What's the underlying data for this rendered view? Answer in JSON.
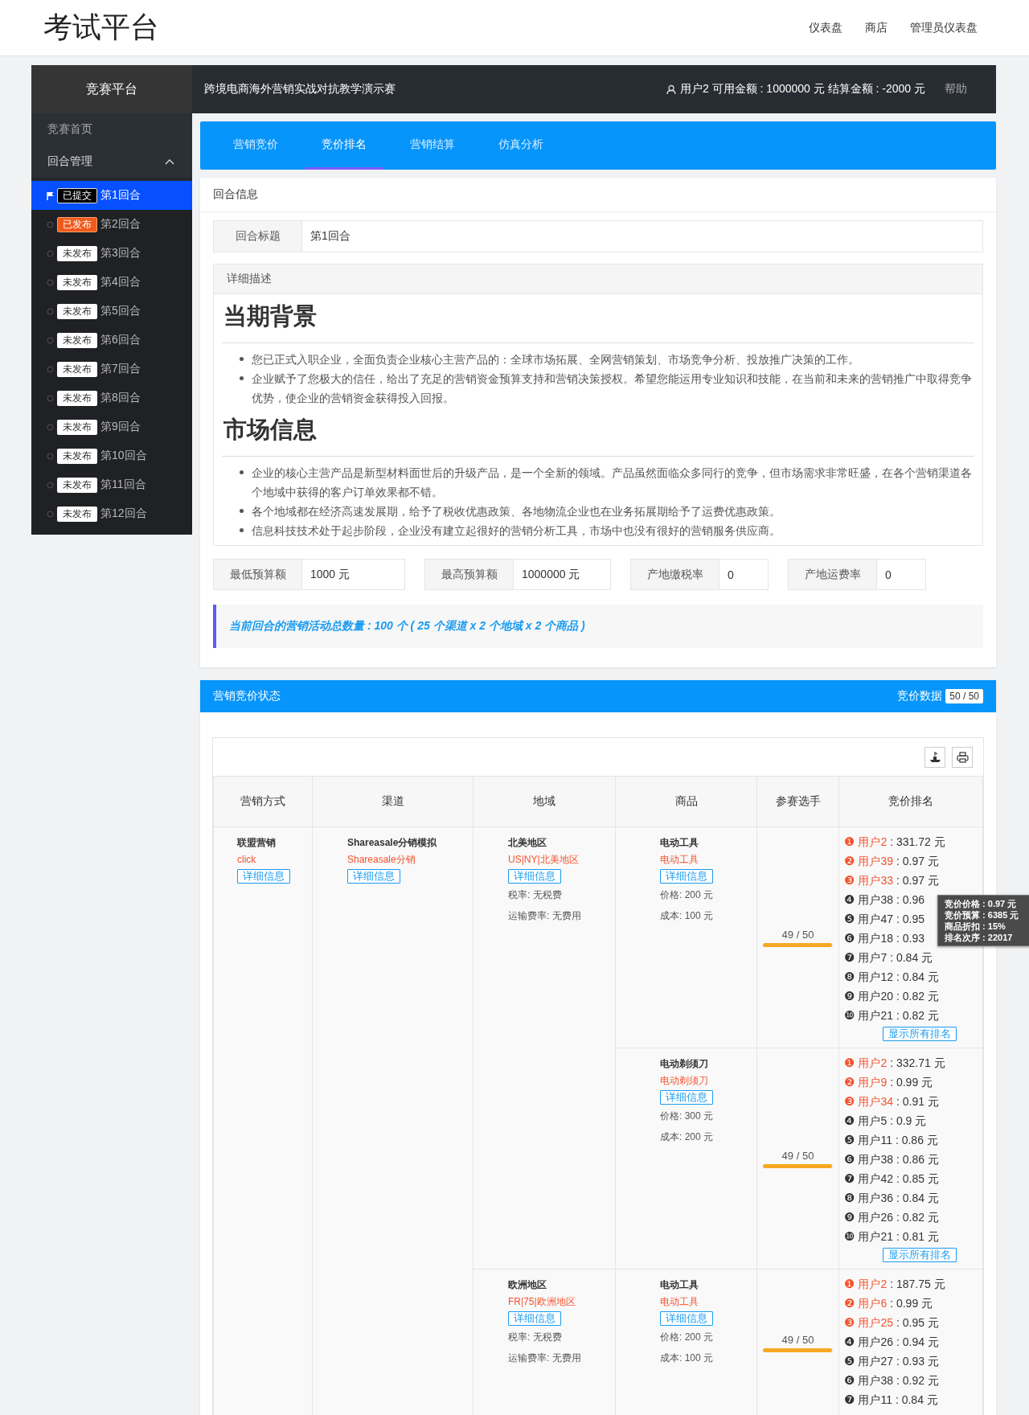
{
  "header": {
    "title": "考试平台",
    "nav": [
      "仪表盘",
      "商店",
      "管理员仪表盘"
    ]
  },
  "topbar": {
    "brand": "竞赛平台",
    "contest": "跨境电商海外营销实战对抗教学演示赛",
    "account": "用户2 可用金额 : 1000000 元 结算金额 : -2000 元",
    "help": "帮助"
  },
  "sidebar": {
    "items": [
      {
        "label": "竞赛首页"
      },
      {
        "label": "回合管理",
        "expanded": true,
        "children": [
          {
            "kind": "submitted",
            "badge": "已提交",
            "label": "第1回合",
            "selected": true
          },
          {
            "kind": "published",
            "badge": "已发布",
            "label": "第2回合",
            "selected": false
          },
          {
            "kind": "unpublished",
            "badge": "未发布",
            "label": "第3回合",
            "selected": false
          },
          {
            "kind": "unpublished",
            "badge": "未发布",
            "label": "第4回合",
            "selected": false
          },
          {
            "kind": "unpublished",
            "badge": "未发布",
            "label": "第5回合",
            "selected": false
          },
          {
            "kind": "unpublished",
            "badge": "未发布",
            "label": "第6回合",
            "selected": false
          },
          {
            "kind": "unpublished",
            "badge": "未发布",
            "label": "第7回合",
            "selected": false
          },
          {
            "kind": "unpublished",
            "badge": "未发布",
            "label": "第8回合",
            "selected": false
          },
          {
            "kind": "unpublished",
            "badge": "未发布",
            "label": "第9回合",
            "selected": false
          },
          {
            "kind": "unpublished",
            "badge": "未发布",
            "label": "第10回合",
            "selected": false
          },
          {
            "kind": "unpublished",
            "badge": "未发布",
            "label": "第11回合",
            "selected": false
          },
          {
            "kind": "unpublished",
            "badge": "未发布",
            "label": "第12回合",
            "selected": false
          }
        ]
      }
    ]
  },
  "tabs": [
    {
      "label": "营销竞价",
      "selected": false
    },
    {
      "label": "竞价排名",
      "selected": true
    },
    {
      "label": "营销结算",
      "selected": false
    },
    {
      "label": "仿真分析",
      "selected": false
    }
  ],
  "round_info": {
    "title": "回合信息",
    "fields": [
      {
        "label": "回合标题",
        "value": "第1回合"
      }
    ],
    "description": {
      "title": "详细描述",
      "sections": [
        {
          "heading": "当期背景",
          "items": [
            "您已正式入职企业，全面负责企业核心主营产品的：全球市场拓展、全网营销策划、市场竞争分析、投放推广决策的工作。",
            "企业赋予了您极大的信任，给出了充足的营销资金预算支持和营销决策授权。希望您能运用专业知识和技能，在当前和未来的营销推广中取得竞争优势，使企业的营销资金获得投入回报。"
          ]
        },
        {
          "heading": "市场信息",
          "items": [
            "企业的核心主营产品是新型材料面世后的升级产品，是一个全新的领域。产品虽然面临众多同行的竞争，但市场需求非常旺盛，在各个营销渠道各个地域中获得的客户订单效果都不错。",
            "各个地域都在经济高速发展期，给予了税收优惠政策、各地物流企业也在业务拓展期给予了运费优惠政策。",
            "信息科技技术处于起步阶段，企业没有建立起很好的营销分析工具，市场中也没有很好的营销服务供应商。"
          ]
        }
      ]
    },
    "params": [
      {
        "label": "最低预算额",
        "value": "1000 元"
      },
      {
        "label": "最高预算额",
        "value": "1000000 元"
      },
      {
        "label": "产地缴税率",
        "value": "0"
      },
      {
        "label": "产地运费率",
        "value": "0"
      }
    ],
    "note": "当前回合的营销活动总数量 : 100 个 ( 25 个渠道 x 2 个地域 x 2 个商品 )"
  },
  "bidding": {
    "title": "营销竞价状态",
    "counter_label": "竞价数据",
    "counter": "50 / 50",
    "columns": [
      "营销方式",
      "渠道",
      "地域",
      "商品",
      "参赛选手",
      "竞价排名"
    ],
    "methods": [
      {
        "name": "联盟营销",
        "code": "click",
        "detail": "详细信息",
        "channels": [
          {
            "name": "Shareasale分销模拟",
            "code": "Shareasale分销",
            "detail": "详细信息",
            "regions": [
              {
                "name": "北美地区",
                "code": "US|NY|北美地区",
                "detail": "详细信息",
                "tax": "税率: 无税费",
                "shipping": "运输费率: 无费用",
                "products": [
                  {
                    "name": "电动工具",
                    "code": "电动工具",
                    "detail": "详细信息",
                    "price": "价格: 200 元",
                    "cost": "成本: 100 元",
                    "players": "49 / 50",
                    "level": 0.98,
                    "show_all": "显示所有排名",
                    "tooltip": [
                      "竞价价格 : 0.97 元",
                      "竞价预算 : 6385 元",
                      "商品折扣 : 15%",
                      "排名次序 : 22017"
                    ],
                    "ranking": [
                      {
                        "rank": "❶",
                        "user": "用户2",
                        "bid": ": 331.72 元",
                        "leader": true
                      },
                      {
                        "rank": "❷",
                        "user": "用户39",
                        "bid": ": 0.97 元",
                        "leader": true
                      },
                      {
                        "rank": "❸",
                        "user": "用户33",
                        "bid": ": 0.97 元",
                        "leader": true
                      },
                      {
                        "rank": "❹",
                        "user": "用户38",
                        "bid": ": 0.96",
                        "leader": false
                      },
                      {
                        "rank": "❺",
                        "user": "用户47",
                        "bid": ": 0.95",
                        "leader": false
                      },
                      {
                        "rank": "❻",
                        "user": "用户18",
                        "bid": ": 0.93",
                        "leader": false
                      },
                      {
                        "rank": "❼",
                        "user": "用户7",
                        "bid": ": 0.84 元",
                        "leader": false
                      },
                      {
                        "rank": "❽",
                        "user": "用户12",
                        "bid": ": 0.84 元",
                        "leader": false
                      },
                      {
                        "rank": "❾",
                        "user": "用户20",
                        "bid": ": 0.82 元",
                        "leader": false
                      },
                      {
                        "rank": "❿",
                        "user": "用户21",
                        "bid": ": 0.82 元",
                        "leader": false
                      }
                    ]
                  },
                  {
                    "name": "电动剃须刀",
                    "code": "电动剃须刀",
                    "detail": "详细信息",
                    "price": "价格: 300 元",
                    "cost": "成本: 200 元",
                    "players": "49 / 50",
                    "level": 0.98,
                    "show_all": "显示所有排名",
                    "ranking": [
                      {
                        "rank": "❶",
                        "user": "用户2",
                        "bid": ": 332.71 元",
                        "leader": true
                      },
                      {
                        "rank": "❷",
                        "user": "用户9",
                        "bid": ": 0.99 元",
                        "leader": true
                      },
                      {
                        "rank": "❸",
                        "user": "用户34",
                        "bid": ": 0.91 元",
                        "leader": true
                      },
                      {
                        "rank": "❹",
                        "user": "用户5",
                        "bid": ": 0.9 元",
                        "leader": false
                      },
                      {
                        "rank": "❺",
                        "user": "用户11",
                        "bid": ": 0.86 元",
                        "leader": false
                      },
                      {
                        "rank": "❻",
                        "user": "用户38",
                        "bid": ": 0.86 元",
                        "leader": false
                      },
                      {
                        "rank": "❼",
                        "user": "用户42",
                        "bid": ": 0.85 元",
                        "leader": false
                      },
                      {
                        "rank": "❽",
                        "user": "用户36",
                        "bid": ": 0.84 元",
                        "leader": false
                      },
                      {
                        "rank": "❾",
                        "user": "用户26",
                        "bid": ": 0.82 元",
                        "leader": false
                      },
                      {
                        "rank": "❿",
                        "user": "用户21",
                        "bid": ": 0.81 元",
                        "leader": false
                      }
                    ]
                  }
                ]
              },
              {
                "name": "欧洲地区",
                "code": "FR|75|欧洲地区",
                "detail": "详细信息",
                "tax": "税率: 无税费",
                "shipping": "运输费率: 无费用",
                "products": [
                  {
                    "name": "电动工具",
                    "code": "电动工具",
                    "detail": "详细信息",
                    "price": "价格: 200 元",
                    "cost": "成本: 100 元",
                    "players": "49 / 50",
                    "level": 0.98,
                    "ranking": [
                      {
                        "rank": "❶",
                        "user": "用户2",
                        "bid": ": 187.75 元",
                        "leader": true
                      },
                      {
                        "rank": "❷",
                        "user": "用户6",
                        "bid": ": 0.99 元",
                        "leader": true
                      },
                      {
                        "rank": "❸",
                        "user": "用户25",
                        "bid": ": 0.95 元",
                        "leader": true
                      },
                      {
                        "rank": "❹",
                        "user": "用户26",
                        "bid": ": 0.94 元",
                        "leader": false
                      },
                      {
                        "rank": "❺",
                        "user": "用户27",
                        "bid": ": 0.93 元",
                        "leader": false
                      },
                      {
                        "rank": "❻",
                        "user": "用户38",
                        "bid": ": 0.92 元",
                        "leader": false
                      },
                      {
                        "rank": "❼",
                        "user": "用户11",
                        "bid": ": 0.84 元",
                        "leader": false
                      }
                    ]
                  }
                ]
              }
            ]
          }
        ]
      }
    ]
  }
}
